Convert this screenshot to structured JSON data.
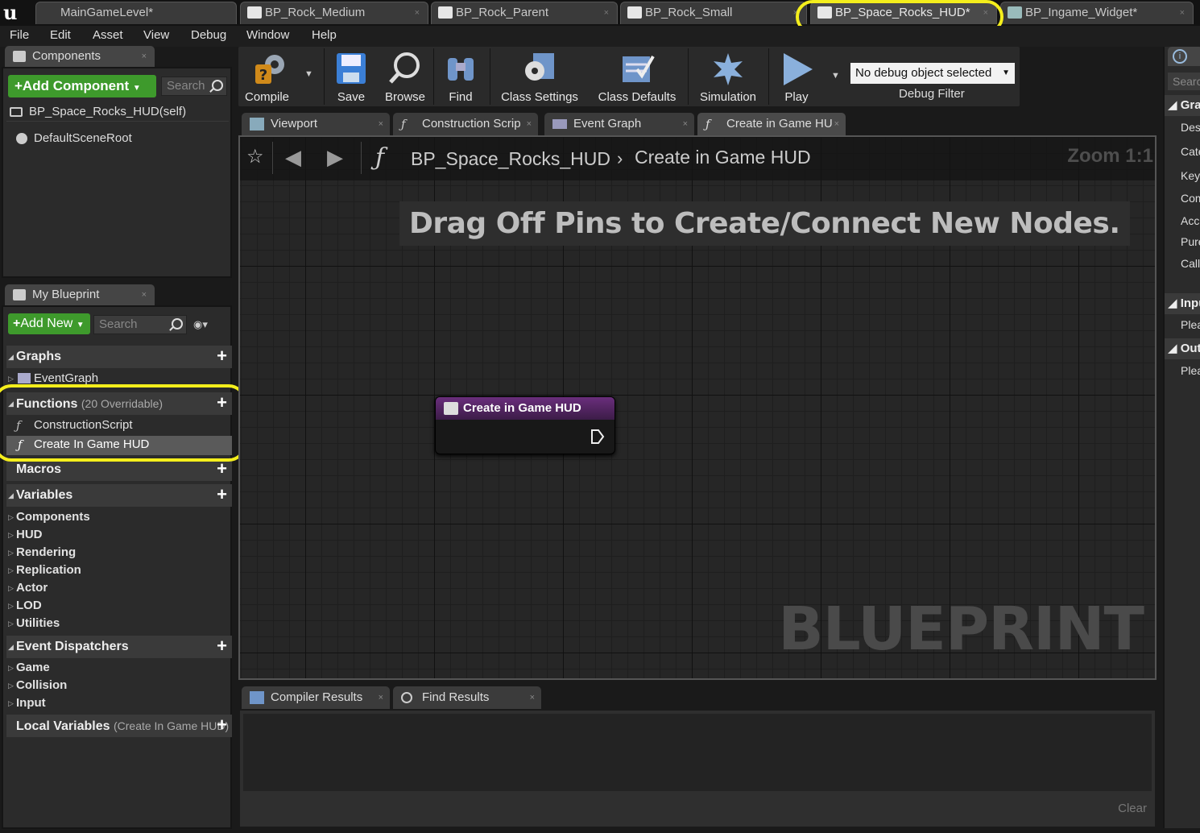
{
  "doc_tabs": [
    {
      "label": "MainGameLevel*"
    },
    {
      "label": "BP_Rock_Medium"
    },
    {
      "label": "BP_Rock_Parent"
    },
    {
      "label": "BP_Rock_Small"
    },
    {
      "label": "BP_Space_Rocks_HUD*"
    },
    {
      "label": "BP_Ingame_Widget*"
    }
  ],
  "menu": [
    "File",
    "Edit",
    "Asset",
    "View",
    "Debug",
    "Window",
    "Help"
  ],
  "components": {
    "tab_label": "Components",
    "add_label": "+Add Component",
    "search_placeholder": "Search",
    "self_label": "BP_Space_Rocks_HUD(self)",
    "root_label": "DefaultSceneRoot"
  },
  "my_blueprint": {
    "tab_label": "My Blueprint",
    "add_label": "Add New",
    "search_placeholder": "Search",
    "graphs_label": "Graphs",
    "event_graph_label": "EventGraph",
    "functions_label": "Functions",
    "functions_note": "(20 Overridable)",
    "functions": [
      "ConstructionScript",
      "Create In Game HUD"
    ],
    "macros_label": "Macros",
    "variables_label": "Variables",
    "variable_categories": [
      "Components",
      "HUD",
      "Rendering",
      "Replication",
      "Actor",
      "LOD",
      "Utilities"
    ],
    "dispatchers_label": "Event Dispatchers",
    "dispatcher_categories": [
      "Game",
      "Collision",
      "Input"
    ],
    "local_vars_label": "Local Variables",
    "local_vars_note": "(Create In Game HUD)"
  },
  "toolbar": {
    "compile": "Compile",
    "save": "Save",
    "browse": "Browse",
    "find": "Find",
    "class_settings": "Class Settings",
    "class_defaults": "Class Defaults",
    "simulation": "Simulation",
    "play": "Play",
    "debug_select": "No debug object selected",
    "debug_filter": "Debug Filter"
  },
  "graph_tabs": [
    "Viewport",
    "Construction Scrip",
    "Event Graph",
    "Create in Game HU"
  ],
  "graph": {
    "breadcrumb_bp": "BP_Space_Rocks_HUD",
    "breadcrumb_fn": "Create in Game HUD",
    "zoom": "Zoom 1:1",
    "hint": "Drag Off Pins to Create/Connect New Nodes.",
    "watermark": "BLUEPRINT",
    "node_title": "Create in Game HUD"
  },
  "bottom": {
    "compiler_tab": "Compiler Results",
    "find_tab": "Find Results",
    "clear": "Clear"
  },
  "right_panel": {
    "search_placeholder": "Searc",
    "section_graph": "Gra",
    "rows": [
      "Des",
      "Cate",
      "Key",
      "Com",
      "Acc",
      "Pure",
      "Call"
    ],
    "section_inputs": "Inpu",
    "inputs_row": "Plea",
    "section_outputs": "Out",
    "outputs_row": "Plea"
  },
  "colors": {
    "highlight": "#f4ee1c",
    "add_button": "#3e9a2c",
    "node_header": "#5a2a6a"
  }
}
